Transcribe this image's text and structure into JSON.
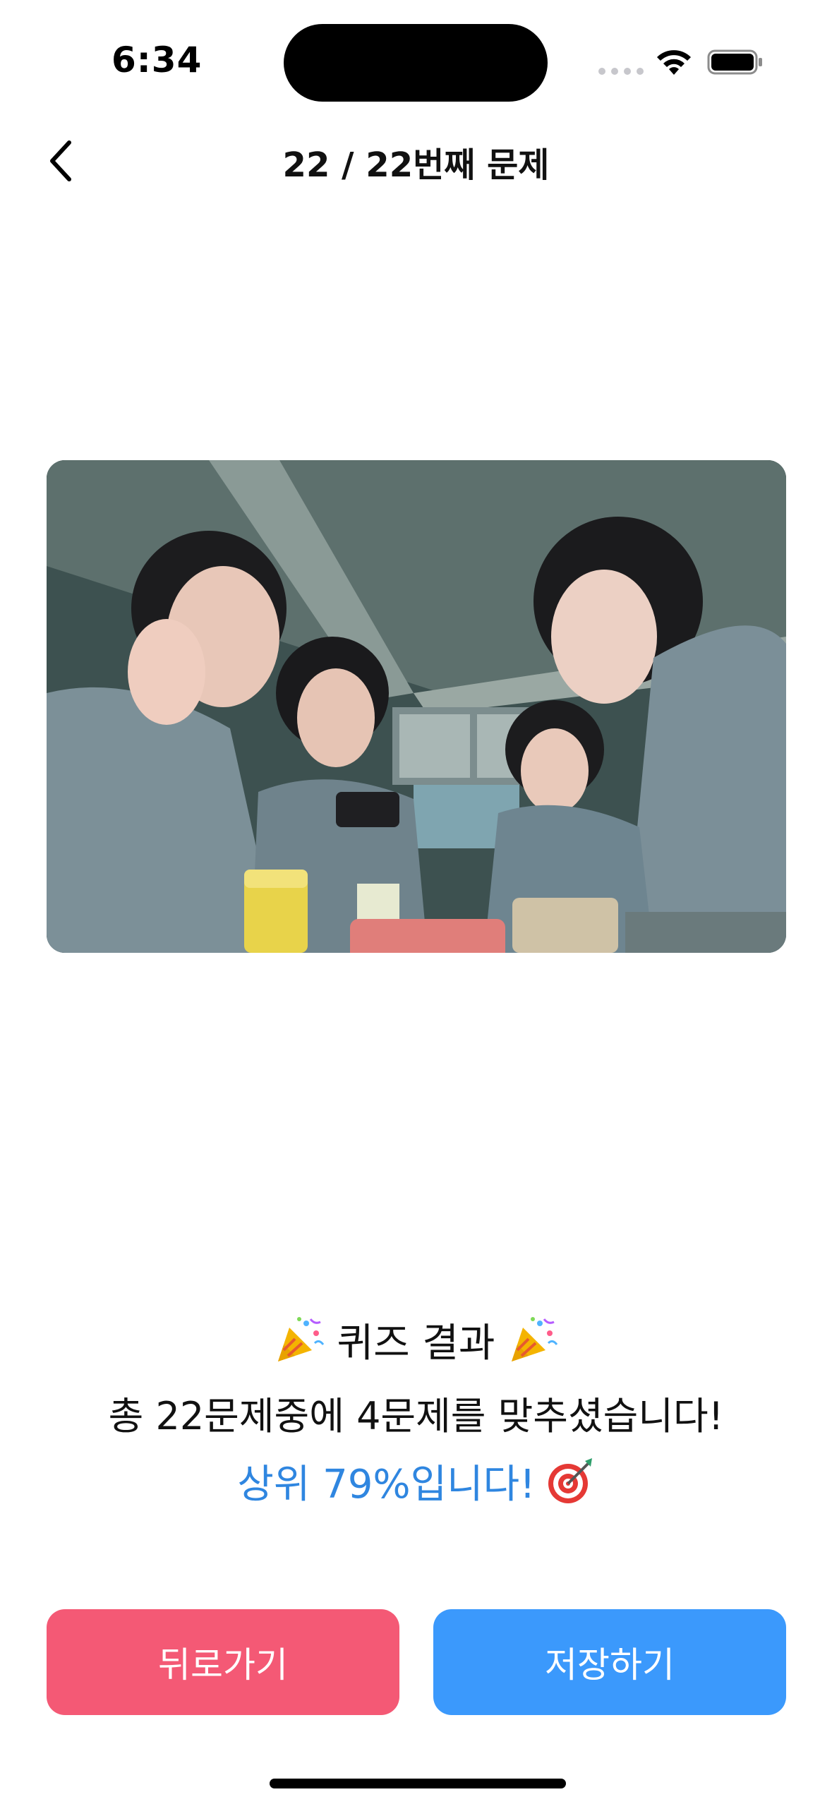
{
  "status_bar": {
    "time": "6:34"
  },
  "nav": {
    "title": "22 / 22번째 문제"
  },
  "photo": {
    "description_icon": "group-photo"
  },
  "result": {
    "title": "퀴즈 결과",
    "summary": "총 22문제중에 4문제를 맞추셨습니다!",
    "rank": "상위 79%입니다!",
    "rank_color": "#2f86e0"
  },
  "buttons": {
    "back_label": "뒤로가기",
    "back_color": "#f45975",
    "save_label": "저장하기",
    "save_color": "#3b99fc"
  }
}
